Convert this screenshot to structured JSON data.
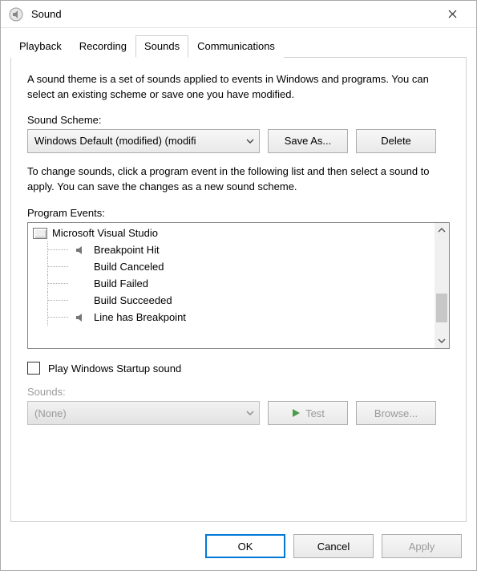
{
  "window": {
    "title": "Sound"
  },
  "tabs": {
    "playback": "Playback",
    "recording": "Recording",
    "sounds": "Sounds",
    "communications": "Communications",
    "active": "sounds"
  },
  "description1": "A sound theme is a set of sounds applied to events in Windows and programs.  You can select an existing scheme or save one you have modified.",
  "scheme_label": "Sound Scheme:",
  "scheme_value": "Windows Default (modified) (modifi",
  "save_as_label": "Save As...",
  "delete_label": "Delete",
  "description2": "To change sounds, click a program event in the following list and then select a sound to apply.  You can save the changes as a new sound scheme.",
  "events_label": "Program Events:",
  "events": {
    "root": "Microsoft Visual Studio",
    "items": [
      {
        "label": "Breakpoint Hit",
        "has_sound": true
      },
      {
        "label": "Build Canceled",
        "has_sound": false
      },
      {
        "label": "Build Failed",
        "has_sound": false
      },
      {
        "label": "Build Succeeded",
        "has_sound": false
      },
      {
        "label": "Line has Breakpoint",
        "has_sound": true
      }
    ]
  },
  "play_startup_label": "Play Windows Startup sound",
  "play_startup_checked": false,
  "sounds_label": "Sounds:",
  "sounds_value": "(None)",
  "test_label": "Test",
  "browse_label": "Browse...",
  "buttons": {
    "ok": "OK",
    "cancel": "Cancel",
    "apply": "Apply"
  }
}
